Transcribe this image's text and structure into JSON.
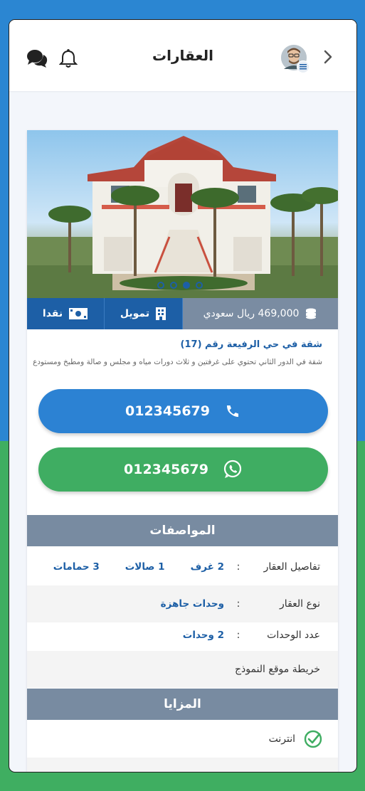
{
  "header": {
    "title": "العقارات"
  },
  "listing": {
    "price": "469,000 ريال سعودي",
    "finance_label": "تمويل",
    "cash_label": "نقدا",
    "title": "شقة في حي الرفيعة رقم (17)",
    "description": "شقة في الدور الثاني تحتوي على غرفتين و ثلاث دورات مياه و مجلس و صالة ومطبخ ومستودع",
    "phone": "012345679",
    "whatsapp": "012345679",
    "image_count": 4,
    "active_image": 2
  },
  "specs": {
    "heading": "المواصفات",
    "details_label": "تفاصيل العقار",
    "rooms": "2 غرف",
    "halls": "1 صالات",
    "baths": "3 حمامات",
    "type_label": "نوع العقار",
    "type_value": "وحدات جاهزة",
    "units_label": "عدد الوحدات",
    "units_value": "2 وحدات",
    "colon": ":",
    "map_label": "خريطة موقع النموذج"
  },
  "features": {
    "heading": "المزايا",
    "items": [
      "انترنت"
    ]
  },
  "colors": {
    "primary_blue": "#1d5fa6",
    "call_blue": "#2c82d3",
    "whatsapp_green": "#3fad62",
    "section_gray": "#788ba1"
  }
}
